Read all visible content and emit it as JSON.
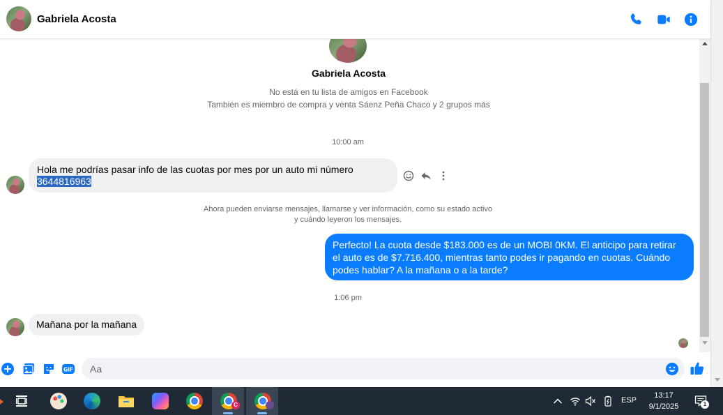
{
  "colors": {
    "messenger_blue": "#0a7cff",
    "icon_blue": "#0a7cff",
    "bubble_gray": "#f0f0f0",
    "secondary_text": "#65676b",
    "taskbar": "#1f2a36",
    "selection": "#2b68c4"
  },
  "header": {
    "name": "Gabriela Acosta",
    "icons": [
      "phone-icon",
      "video-call-icon",
      "info-icon"
    ]
  },
  "profile": {
    "name": "Gabriela Acosta",
    "line_1": "No está en tu lista de amigos en Facebook",
    "line_2": "También es miembro de compra y venta Sáenz Peña Chaco y 2 grupos más"
  },
  "conversation": {
    "timestamp_1": "10:00 am",
    "message_1": {
      "text": "Hola me podrías pasar info de las cuotas por mes por un auto mi número",
      "selected_text": "3644816963",
      "direction": "incoming"
    },
    "notice_line_1": "Ahora pueden enviarse mensajes, llamarse y ver información, como su estado activo",
    "notice_line_2": "y cuándo leyeron los mensajes.",
    "message_2": {
      "text": "Perfecto! La cuota desde $183.000 es de un MOBI 0KM. El anticipo para retirar el auto es de $7.716.400, mientras tanto podes ir pagando en cuotas. Cuándo podes hablar? A la mañana o a la tarde?",
      "direction": "outgoing"
    },
    "timestamp_2": "1:06 pm",
    "message_3": {
      "text": "Mañana por la mañana",
      "direction": "incoming"
    }
  },
  "composer": {
    "placeholder": "Aa",
    "icons": [
      "plus-icon",
      "image-icon",
      "sticker-icon",
      "gif-icon",
      "emoji-icon",
      "thumbs-up-icon"
    ],
    "gif_label": "GIF"
  },
  "taskbar": {
    "apps": [
      "task-view",
      "paint",
      "edge",
      "file-explorer",
      "copilot",
      "chrome",
      "chrome-profile-c",
      "chrome-profile-2"
    ],
    "chrome_profile_badge": "C",
    "language": "ESP",
    "time": "13:17",
    "date": "9/1/2025",
    "notification_count": "1"
  }
}
